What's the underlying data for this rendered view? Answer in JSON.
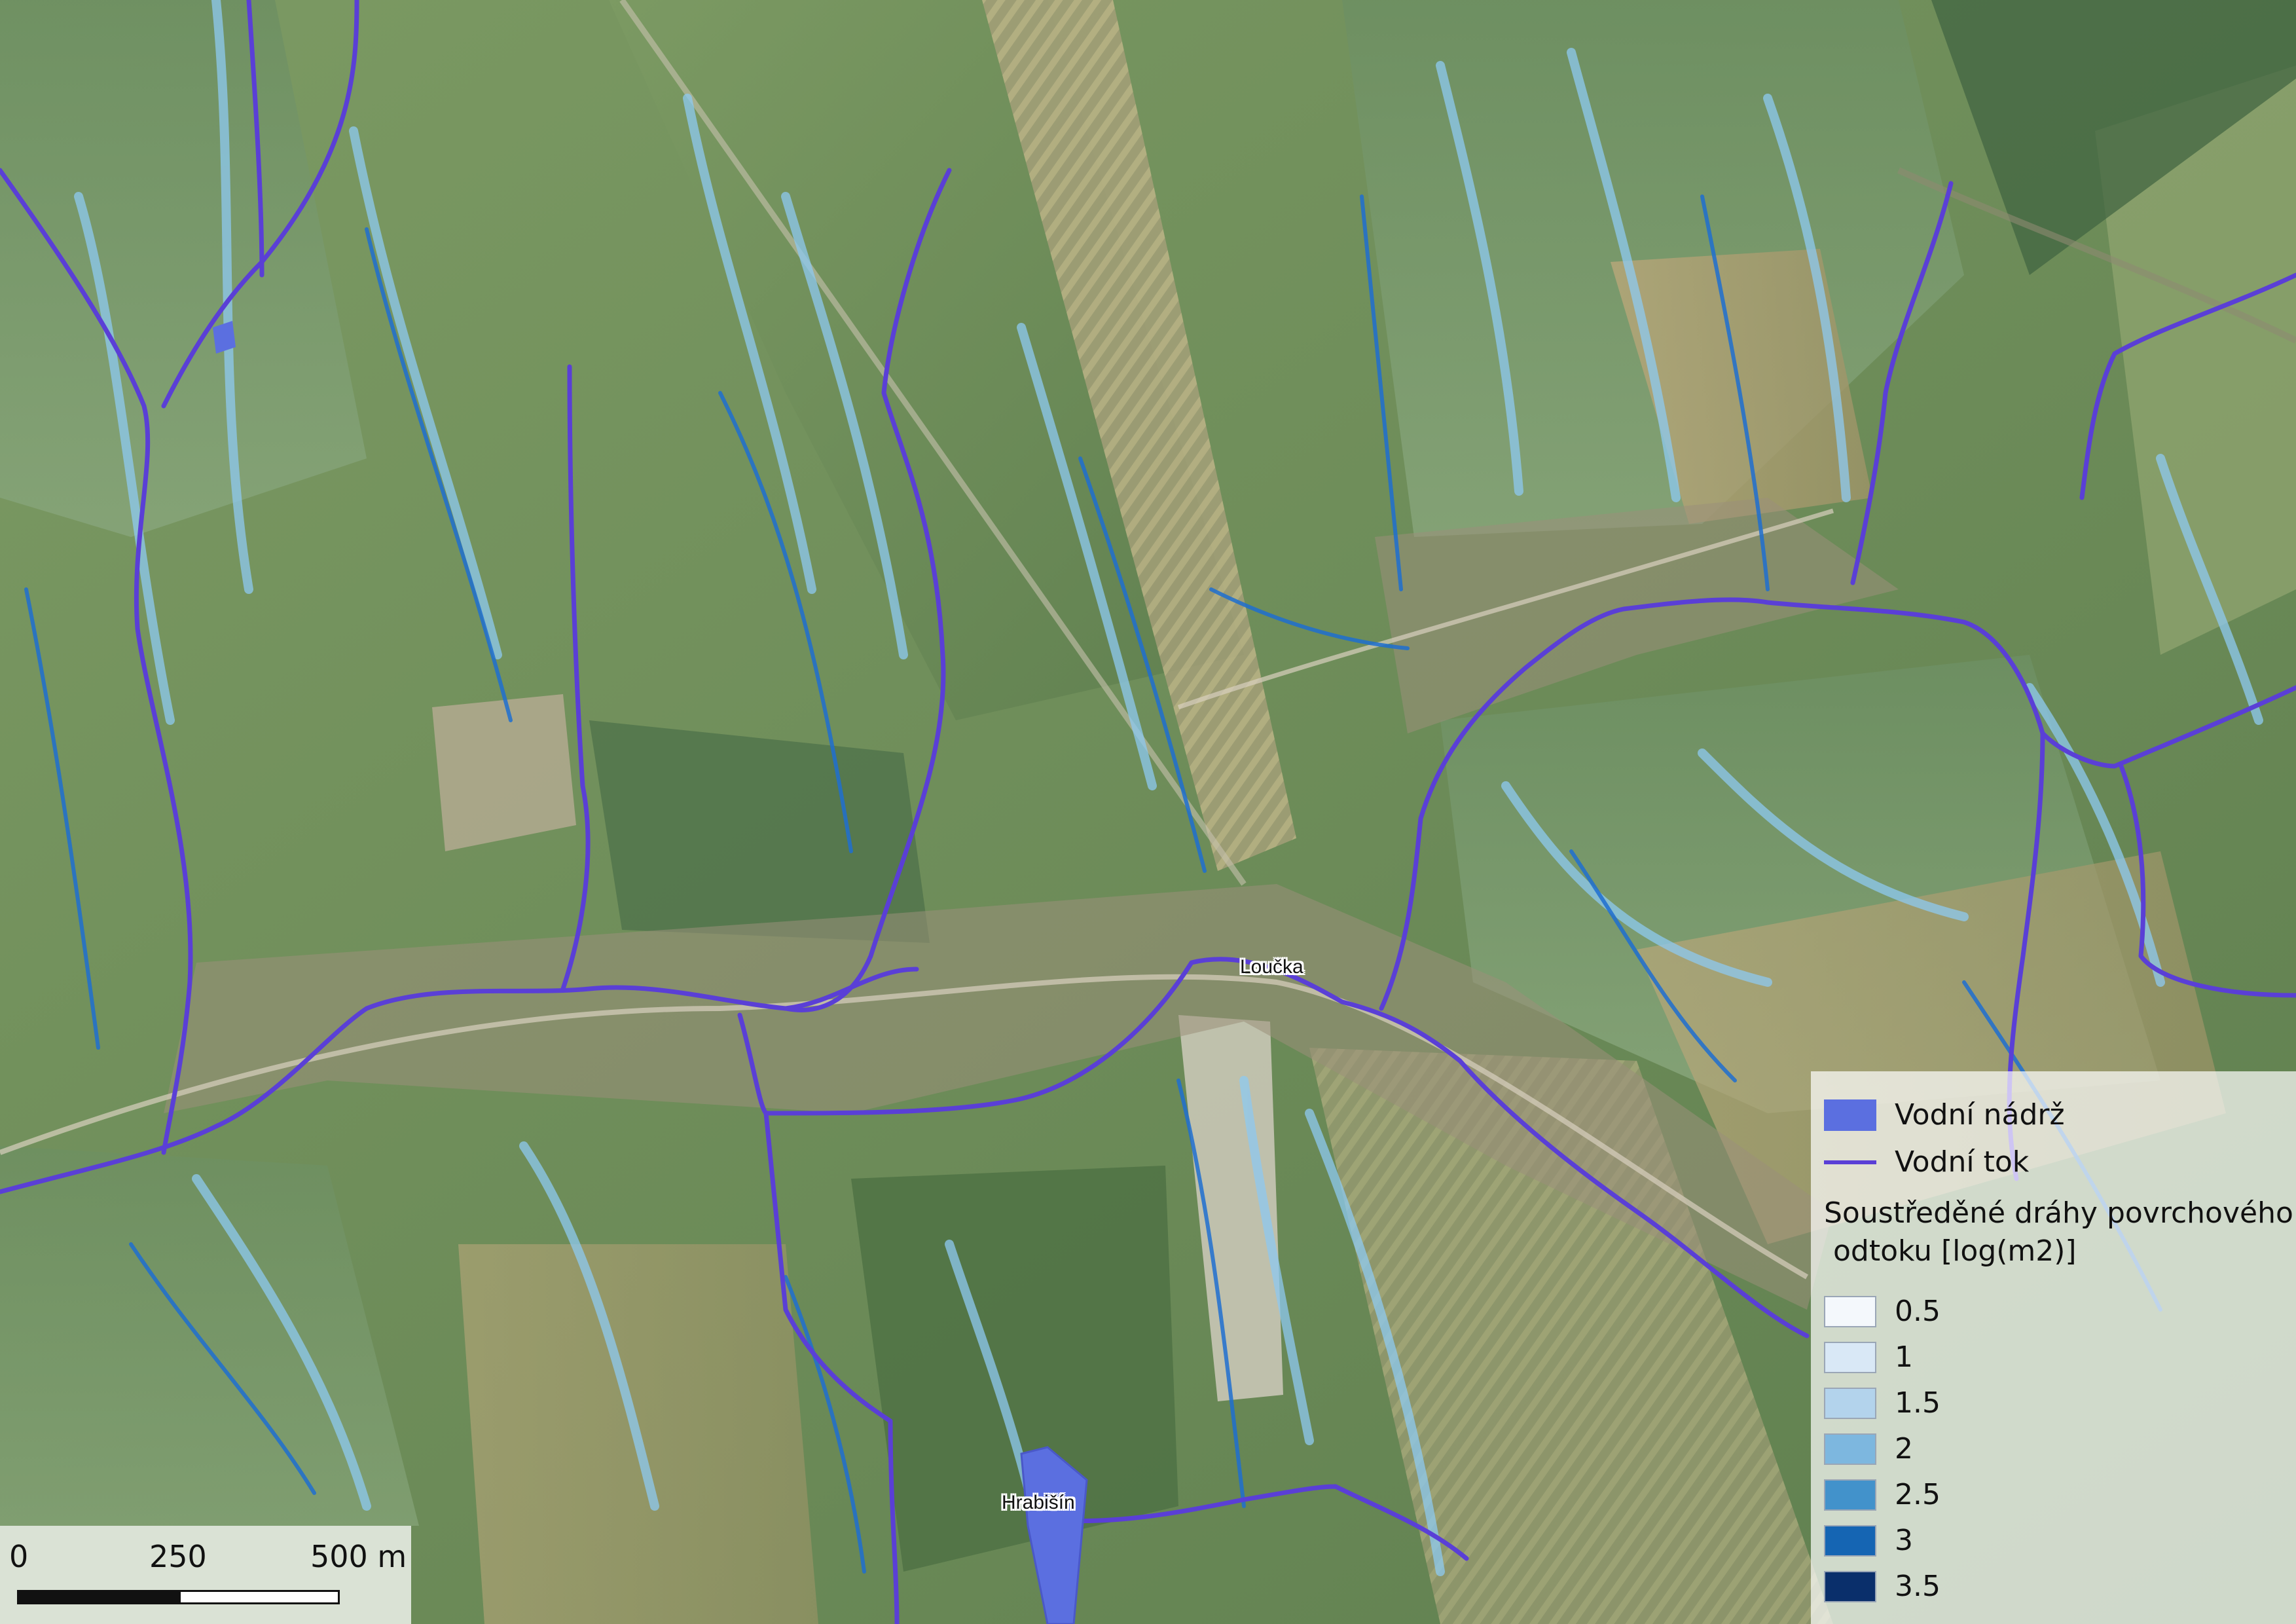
{
  "map": {
    "places": [
      {
        "name": "Loučka"
      },
      {
        "name": "Hrabišín"
      }
    ],
    "colors": {
      "stream": "#5a3fd6",
      "reservoir": "#5b6fe0",
      "flow_low": "#8ec9f0",
      "flow_high": "#1e6fd0"
    }
  },
  "legend": {
    "reservoir_label": "Vodní nádrž",
    "stream_label": "Vodní tok",
    "title_line1": "Soustředěné dráhy povrchového",
    "title_line2": " odtoku [log(m2)]",
    "classes": [
      {
        "label": "0.5",
        "color": "#f4f8fc"
      },
      {
        "label": "1",
        "color": "#d9e8f6"
      },
      {
        "label": "1.5",
        "color": "#b3d3ec"
      },
      {
        "label": "2",
        "color": "#7db7df"
      },
      {
        "label": "2.5",
        "color": "#4292cb"
      },
      {
        "label": "3",
        "color": "#1565b3"
      },
      {
        "label": "3.5",
        "color": "#0a2f6b"
      }
    ]
  },
  "scalebar": {
    "labels": [
      "0",
      "250",
      "500 m"
    ]
  }
}
